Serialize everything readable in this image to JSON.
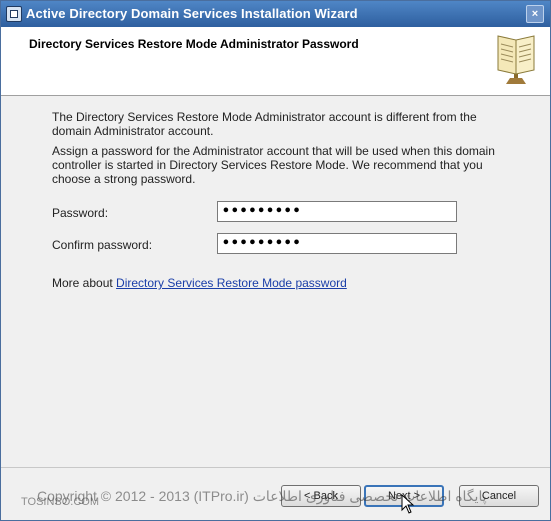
{
  "window": {
    "title": "Active Directory Domain Services Installation Wizard",
    "close_glyph": "×"
  },
  "header": {
    "title": "Directory Services Restore Mode Administrator Password",
    "icon": "book-icon"
  },
  "content": {
    "intro": "The Directory Services Restore Mode Administrator account is different from the domain Administrator account.",
    "instructions": "Assign a password for the Administrator account that will be used when this domain controller is started in Directory Services Restore Mode. We recommend that you choose a strong password.",
    "password_label": "Password:",
    "password_value": "•••••••••",
    "confirm_label": "Confirm password:",
    "confirm_value": "•••••••••",
    "more_prefix": "More about",
    "more_link": "Directory Services Restore Mode password"
  },
  "footer": {
    "back_label": "< Back",
    "next_label": "Next >",
    "cancel_label": "Cancel",
    "watermark": "Copyright © 2012 - 2013 (ITPro.ir) پایگاه اطلاعات تخصصی فناوری اطلاعات",
    "watermark_site": "TOSINSO.COM"
  },
  "colors": {
    "title_bar": "#2e5f9f",
    "link": "#1a3ea8",
    "default_button_border": "#3a74b8"
  }
}
